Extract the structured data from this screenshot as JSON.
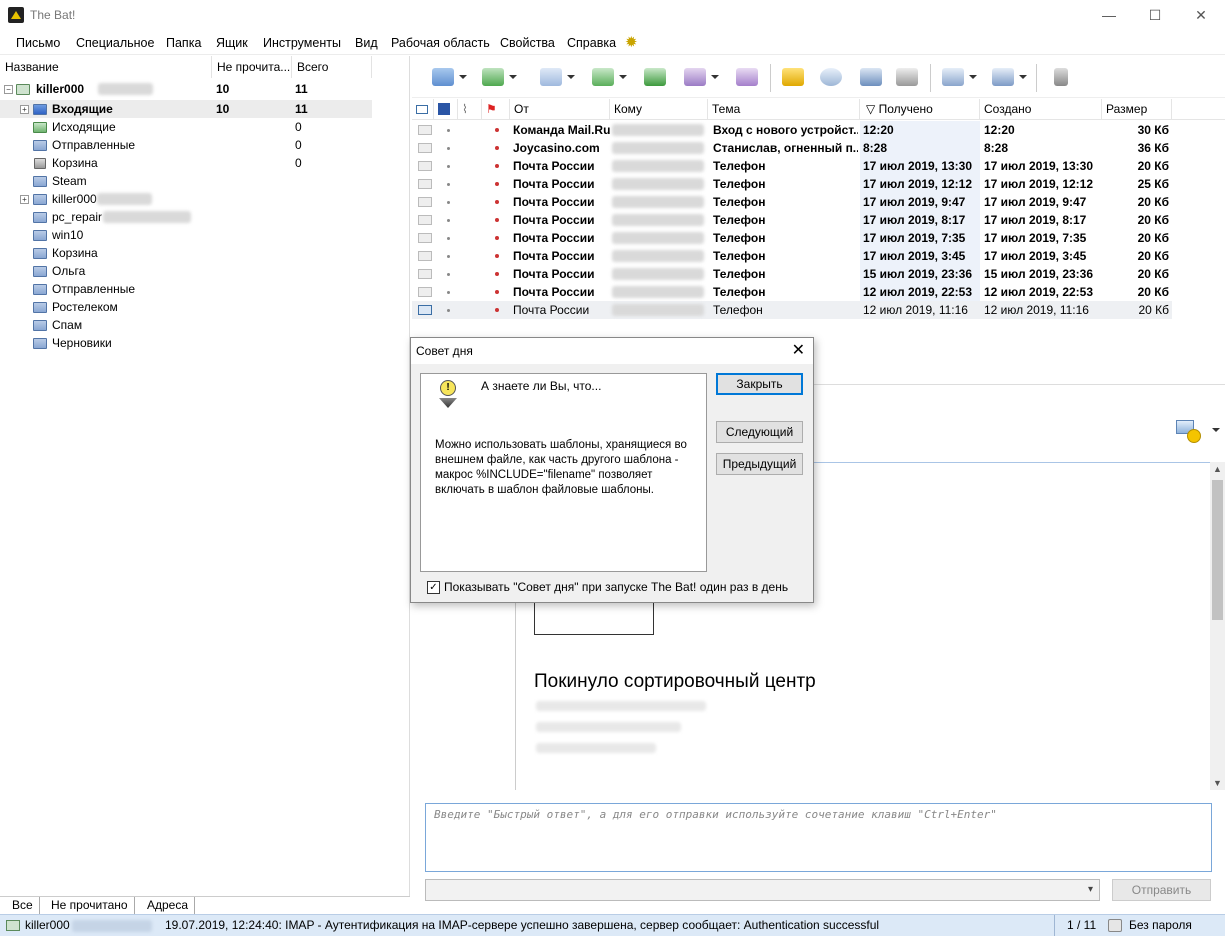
{
  "window": {
    "title": "The Bat!",
    "minimize": "—",
    "maximize": "☐",
    "close": "✕"
  },
  "menu": [
    "Письмо",
    "Специальное",
    "Папка",
    "Ящик",
    "Инструменты",
    "Вид",
    "Рабочая область",
    "Свойства",
    "Справка"
  ],
  "folder_columns": {
    "name": "Название",
    "unread": "Не прочита...",
    "total": "Всего"
  },
  "account": {
    "name": "killer000",
    "unread": "10",
    "total": "11"
  },
  "folders": [
    {
      "label": "Входящие",
      "unread": "10",
      "total": "11",
      "icon": "inbox-icon"
    },
    {
      "label": "Исходящие",
      "unread": "",
      "total": "0",
      "icon": "outbox-icon"
    },
    {
      "label": "Отправленные",
      "unread": "",
      "total": "0",
      "icon": "sent-icon"
    },
    {
      "label": "Корзина",
      "unread": "",
      "total": "0",
      "icon": "trash-icon"
    },
    {
      "label": "Steam",
      "unread": "",
      "total": "",
      "icon": "folder-icon"
    },
    {
      "label": "killer000",
      "unread": "",
      "total": "",
      "icon": "folder-icon"
    },
    {
      "label": "pc_repair",
      "unread": "",
      "total": "",
      "icon": "folder-icon"
    },
    {
      "label": "win10",
      "unread": "",
      "total": "",
      "icon": "folder-icon"
    },
    {
      "label": "Корзина",
      "unread": "",
      "total": "",
      "icon": "folder-icon"
    },
    {
      "label": "Ольга",
      "unread": "",
      "total": "",
      "icon": "folder-icon"
    },
    {
      "label": "Отправленные",
      "unread": "",
      "total": "",
      "icon": "folder-icon"
    },
    {
      "label": "Ростелеком",
      "unread": "",
      "total": "",
      "icon": "folder-icon"
    },
    {
      "label": "Спам",
      "unread": "",
      "total": "",
      "icon": "folder-icon"
    },
    {
      "label": "Черновики",
      "unread": "",
      "total": "",
      "icon": "folder-icon"
    }
  ],
  "left_tabs": [
    "Все",
    "Не прочитано",
    "Адреса"
  ],
  "message_columns": {
    "from": "От",
    "to": "Кому",
    "subject": "Тема",
    "received": "Получено",
    "created": "Создано",
    "size": "Размер"
  },
  "messages": [
    {
      "from": "Команда Mail.Ru",
      "subject": "Вход с нового устройст...",
      "received": "12:20",
      "created": "12:20",
      "size": "30 Кб",
      "unread": true
    },
    {
      "from": "Joycasino.com",
      "subject": "Станислав, огненный п...",
      "received": "8:28",
      "created": "8:28",
      "size": "36 Кб",
      "unread": true
    },
    {
      "from": "Почта России",
      "subject": "Телефон",
      "received": "17 июл 2019, 13:30",
      "created": "17 июл 2019, 13:30",
      "size": "20 Кб",
      "unread": true
    },
    {
      "from": "Почта России",
      "subject": "Телефон",
      "received": "17 июл 2019, 12:12",
      "created": "17 июл 2019, 12:12",
      "size": "25 Кб",
      "unread": true
    },
    {
      "from": "Почта России",
      "subject": "Телефон",
      "received": "17 июл 2019, 9:47",
      "created": "17 июл 2019, 9:47",
      "size": "20 Кб",
      "unread": true
    },
    {
      "from": "Почта России",
      "subject": "Телефон",
      "received": "17 июл 2019, 8:17",
      "created": "17 июл 2019, 8:17",
      "size": "20 Кб",
      "unread": true
    },
    {
      "from": "Почта России",
      "subject": "Телефон",
      "received": "17 июл 2019, 7:35",
      "created": "17 июл 2019, 7:35",
      "size": "20 Кб",
      "unread": true
    },
    {
      "from": "Почта России",
      "subject": "Телефон",
      "received": "17 июл 2019, 3:45",
      "created": "17 июл 2019, 3:45",
      "size": "20 Кб",
      "unread": true
    },
    {
      "from": "Почта России",
      "subject": "Телефон",
      "received": "15 июл 2019, 23:36",
      "created": "15 июл 2019, 23:36",
      "size": "20 Кб",
      "unread": true
    },
    {
      "from": "Почта России",
      "subject": "Телефон",
      "received": "12 июл 2019, 22:53",
      "created": "12 июл 2019, 22:53",
      "size": "20 Кб",
      "unread": true
    },
    {
      "from": "Почта России",
      "subject": "Телефон",
      "received": "12 июл 2019, 11:16",
      "created": "12 июл 2019, 11:16",
      "size": "20 Кб",
      "unread": false
    }
  ],
  "preview": {
    "heading": "Покинуло сортировочный центр"
  },
  "quick_reply": {
    "placeholder": "Введите \"Быстрый ответ\", а для его отправки используйте сочетание клавиш \"Ctrl+Enter\"",
    "send_label": "Отправить"
  },
  "status": {
    "account": "killer000",
    "message": "19.07.2019, 12:24:40: IMAP  - Аутентификация на IMAP-сервере успешно завершена, сервер сообщает: Authentication successful",
    "count": "1 / 11",
    "password": "Без пароля"
  },
  "dialog": {
    "title": "Совет дня",
    "heading": "А знаете ли Вы, что...",
    "tip": "Можно использовать шаблоны, хранящиеся во внешнем файле, как часть другого шаблона - макрос %INCLUDE=\"filename\" позволяет включать в шаблон файловые шаблоны.",
    "close_label": "Закрыть",
    "next_label": "Следующий",
    "prev_label": "Предыдущий",
    "checkbox_label": "Показывать \"Совет дня\" при запуске The Bat! один раз в день",
    "checkbox_checked": true
  }
}
